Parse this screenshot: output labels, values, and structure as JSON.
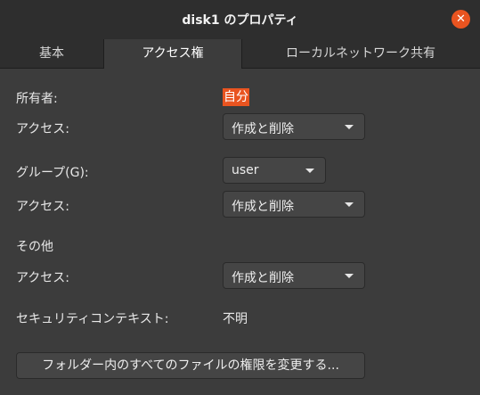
{
  "window": {
    "title": "disk1 のプロパティ",
    "close_symbol": "✕"
  },
  "tabs": [
    {
      "label": "基本"
    },
    {
      "label": "アクセス権"
    },
    {
      "label": "ローカルネットワーク共有"
    }
  ],
  "active_tab": "アクセス権",
  "permissions": {
    "owner_label": "所有者:",
    "owner_value": "自分",
    "owner_access_label": "アクセス:",
    "owner_access_value": "作成と削除",
    "group_label": "グループ(G):",
    "group_value": "user",
    "group_access_label": "アクセス:",
    "group_access_value": "作成と削除",
    "others_label": "その他",
    "others_access_label": "アクセス:",
    "others_access_value": "作成と削除",
    "security_context_label": "セキュリティコンテキスト:",
    "security_context_value": "不明",
    "change_files_button": "フォルダー内のすべてのファイルの権限を変更する..."
  },
  "colors": {
    "accent": "#e95420",
    "window_bg": "#3c3c3c",
    "header_bg": "#2e2e2e"
  },
  "icons": [
    "close-icon",
    "dropdown-arrow-icon"
  ]
}
